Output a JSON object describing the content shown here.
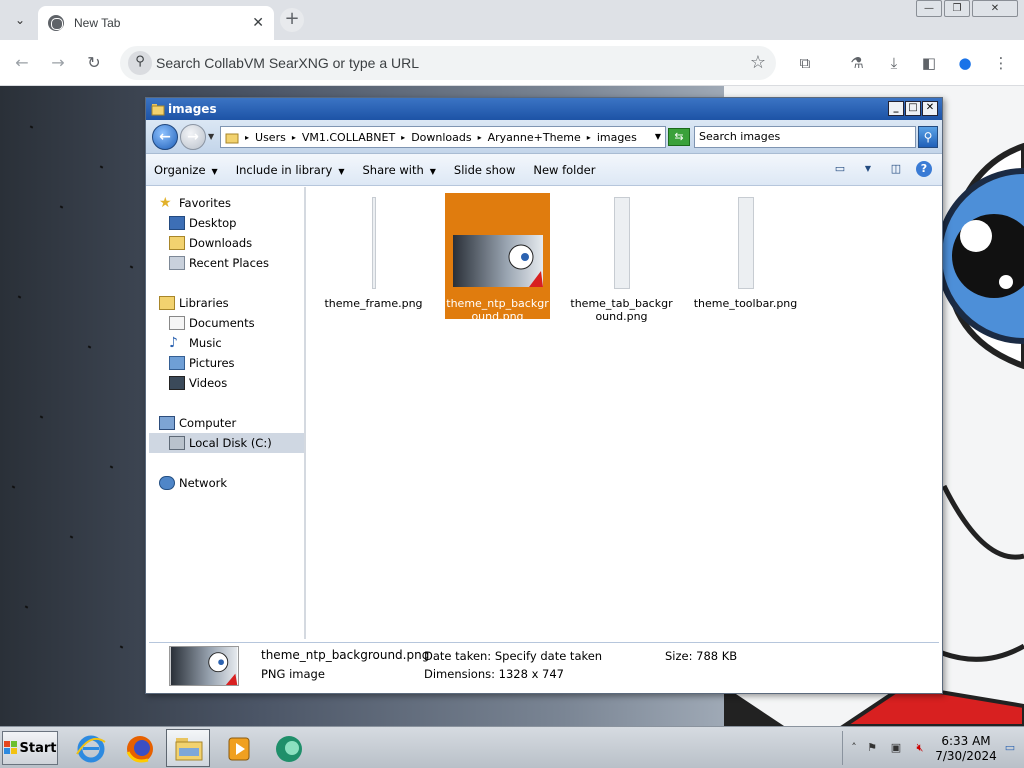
{
  "browser": {
    "tab_title": "New Tab",
    "omnibox_placeholder": "Search CollabVM SearXNG or type a URL"
  },
  "explorer": {
    "title": "images",
    "breadcrumb": [
      "Users",
      "VM1.COLLABNET",
      "Downloads",
      "Aryanne+Theme",
      "images"
    ],
    "search_placeholder": "Search images",
    "commands": {
      "organize": "Organize",
      "include_in_library": "Include in library",
      "share_with": "Share with",
      "slide_show": "Slide show",
      "new_folder": "New folder"
    },
    "nav": {
      "favorites": "Favorites",
      "desktop": "Desktop",
      "downloads": "Downloads",
      "recent_places": "Recent Places",
      "libraries": "Libraries",
      "documents": "Documents",
      "music": "Music",
      "pictures": "Pictures",
      "videos": "Videos",
      "computer": "Computer",
      "local_disk": "Local Disk (C:)",
      "network": "Network"
    },
    "files": [
      {
        "name": "theme_frame.png",
        "selected": false
      },
      {
        "name": "theme_ntp_background.png",
        "selected": true
      },
      {
        "name": "theme_tab_background.png",
        "selected": false
      },
      {
        "name": "theme_toolbar.png",
        "selected": false
      }
    ],
    "details": {
      "filename": "theme_ntp_background.png",
      "type": "PNG image",
      "date_taken": "Date taken: Specify date taken",
      "dimensions": "Dimensions: 1328 x 747",
      "size": "Size:  788 KB"
    }
  },
  "taskbar": {
    "start_label": "Start",
    "clock_time": "6:33 AM",
    "clock_date": "7/30/2024"
  },
  "colors": {
    "selection": "#e07c0e",
    "title_bar": "#1d53a6",
    "nav_selected": "#cfd7e2"
  }
}
